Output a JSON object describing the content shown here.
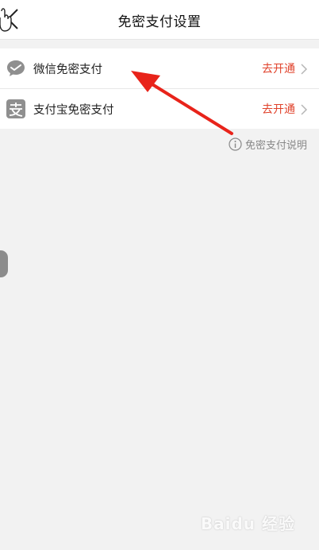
{
  "header": {
    "title": "免密支付设置"
  },
  "payments": [
    {
      "label": "微信免密支付",
      "action": "去开通",
      "icon": "wechat-icon",
      "icon_color": "#8f8f8f"
    },
    {
      "label": "支付宝免密支付",
      "action": "去开通",
      "icon": "alipay-icon",
      "icon_color": "#8f8f8f"
    }
  ],
  "info_link": {
    "label": "免密支付说明",
    "icon": "info-icon"
  },
  "colors": {
    "action": "#e0412a",
    "annotation_arrow": "#e8231a",
    "background": "#f2f2f2"
  },
  "watermark": "Baidu 经验"
}
